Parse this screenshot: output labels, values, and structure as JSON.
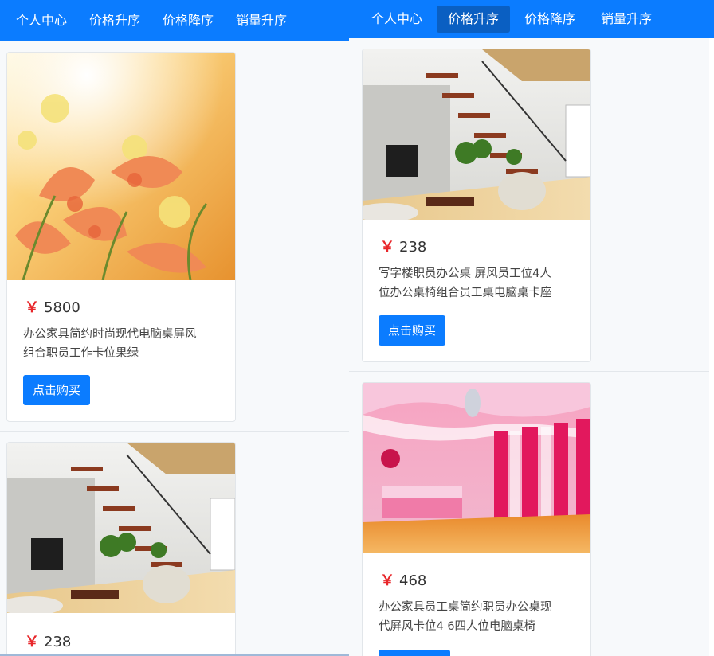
{
  "left": {
    "nav": [
      "个人中心",
      "价格升序",
      "价格降序",
      "销量升序"
    ],
    "cards": [
      {
        "currency": "￥",
        "price": "5800",
        "desc": [
          "办公家具简约时尚现代电脑桌屏风",
          "组合职员工作卡位果绿"
        ],
        "button": "点击购买",
        "image": "lily-flowers-photo"
      },
      {
        "currency": "￥",
        "price": "238",
        "desc": [],
        "button": "",
        "image": "loft-staircase-living-room-photo"
      }
    ]
  },
  "right": {
    "nav": [
      "个人中心",
      "价格升序",
      "价格降序",
      "销量升序"
    ],
    "active_nav": "价格升序",
    "cards": [
      {
        "currency": "￥",
        "price": "238",
        "desc": [
          "写字楼职员办公桌 屏风员工位4人",
          "位办公桌椅组合员工桌电脑桌卡座"
        ],
        "button": "点击购买",
        "image": "loft-staircase-living-room-photo"
      },
      {
        "currency": "￥",
        "price": "468",
        "desc": [
          "办公家具员工桌简约职员办公桌现",
          "代屏风卡位4 6四人位电脑桌椅"
        ],
        "button": "",
        "image": "pink-living-room-photo"
      }
    ]
  },
  "colors": {
    "navbar": "#0b7cff",
    "active_nav": "#0a5fc2",
    "price_symbol": "#e8262a",
    "button": "#0b7cff"
  }
}
